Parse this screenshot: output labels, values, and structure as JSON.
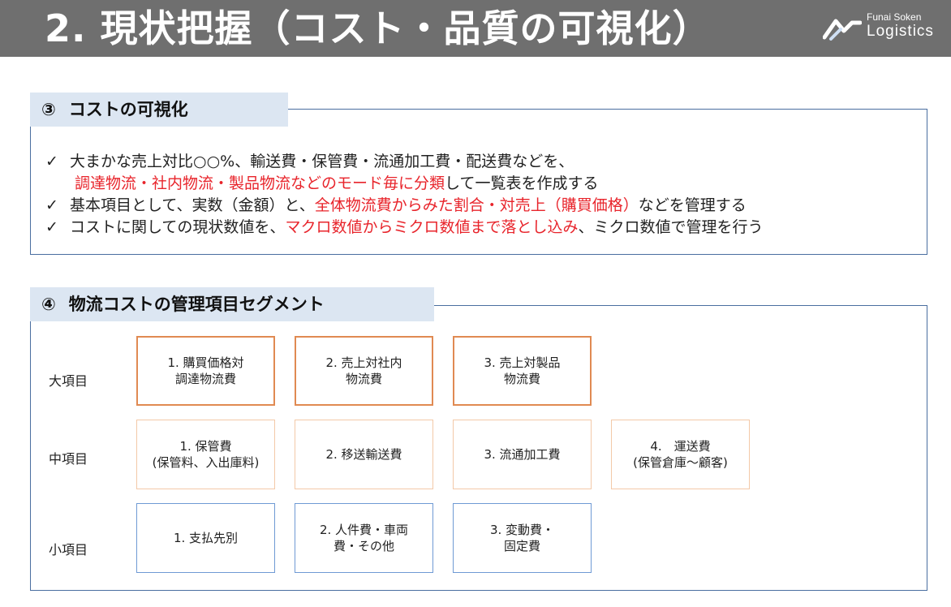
{
  "header": {
    "title": "2. 現状把握（コスト・品質の可視化）",
    "logo_top": "Funai Soken",
    "logo_bottom": "Logistics"
  },
  "section3": {
    "number": "③",
    "title": "コストの可視化",
    "bullets": [
      {
        "check": "✓",
        "line1": "大まかな売上対比○○%、輸送費・保管費・流通加工費・配送費などを、",
        "line2_red": "調達物流・社内物流・製品物流などのモード毎に分類",
        "line2_rest": "して一覧表を作成する"
      },
      {
        "check": "✓",
        "pre": "基本項目として、実数（金額）と、",
        "red": "全体物流費からみた割合・対売上（購買価格）",
        "post": "などを管理する"
      },
      {
        "check": "✓",
        "pre": "コストに関しての現状数値を、",
        "red": "マクロ数値からミクロ数値まで落とし込み",
        "post": "、ミクロ数値で管理を行う"
      }
    ]
  },
  "section4": {
    "number": "④",
    "title": "物流コストの管理項目セグメント",
    "rows": [
      {
        "label": "大項目",
        "cells": [
          "1. 購買価格対\n調達物流費",
          "2. 売上対社内\n物流費",
          "3. 売上対製品\n物流費"
        ]
      },
      {
        "label": "中項目",
        "cells": [
          "1. 保管費\n(保管料、入出庫料)",
          "2. 移送輸送費",
          "3. 流通加工費",
          "4.　運送費\n(保管倉庫～顧客)"
        ]
      },
      {
        "label": "小項目",
        "cells": [
          "1. 支払先別",
          "2. 人件費・車両\n費・その他",
          "3. 変動費・\n固定費"
        ]
      }
    ]
  },
  "colors": {
    "header_bg": "#6f6f6f",
    "tab_bg": "#dce6f2",
    "box_border": "#4a6ea0",
    "red_text": "#e8242b",
    "major_border": "#e08a52",
    "middle_border": "#f3c9a8",
    "minor_border": "#6f9ad4"
  }
}
